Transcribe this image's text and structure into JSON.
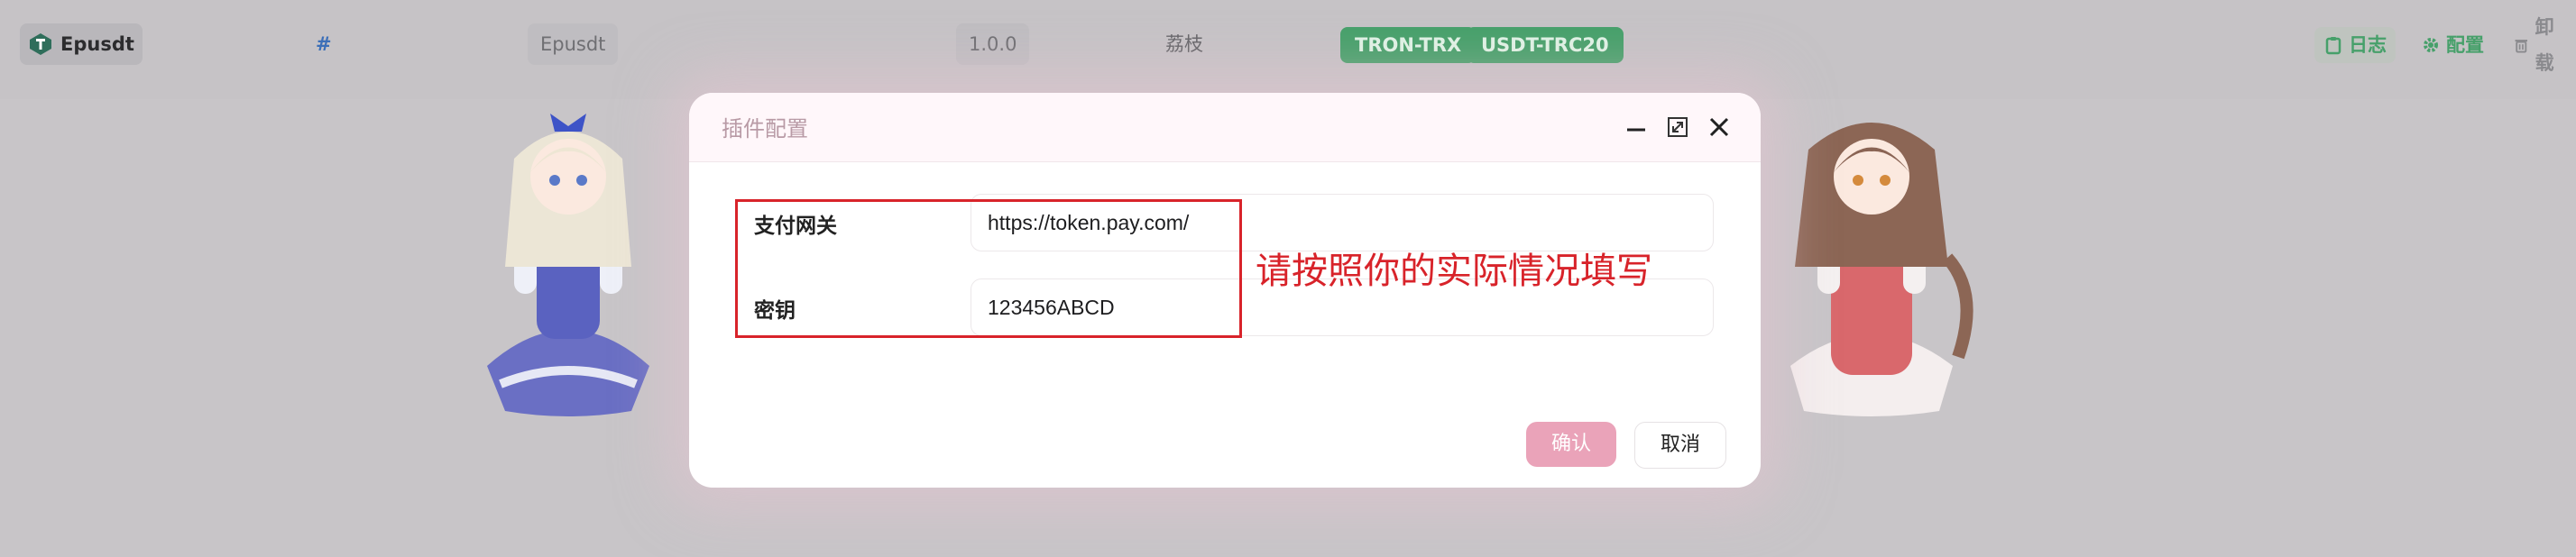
{
  "plugin_row": {
    "name": "Epusdt",
    "hash": "#",
    "title": "Epusdt",
    "version": "1.0.0",
    "author": "荔枝",
    "tags": [
      "TRON-TRX",
      "USDT-TRC20"
    ],
    "actions": {
      "log": "日志",
      "config": "配置",
      "uninstall": "卸载"
    }
  },
  "modal": {
    "title": "插件配置",
    "fields": [
      {
        "label": "支付网关",
        "value": "https://token.pay.com/"
      },
      {
        "label": "密钥",
        "value": "123456ABCD"
      }
    ],
    "annotation": "请按照你的实际情况填写",
    "confirm_label": "确认",
    "cancel_label": "取消"
  },
  "colors": {
    "accent_pink": "#eaa3b9",
    "tag_green": "#46a06a",
    "annotation_red": "#d8232a"
  },
  "icons": [
    "epusdt-logo-icon",
    "clipboard-icon",
    "gear-icon",
    "trash-icon",
    "minimize-icon",
    "maximize-icon",
    "close-icon"
  ]
}
